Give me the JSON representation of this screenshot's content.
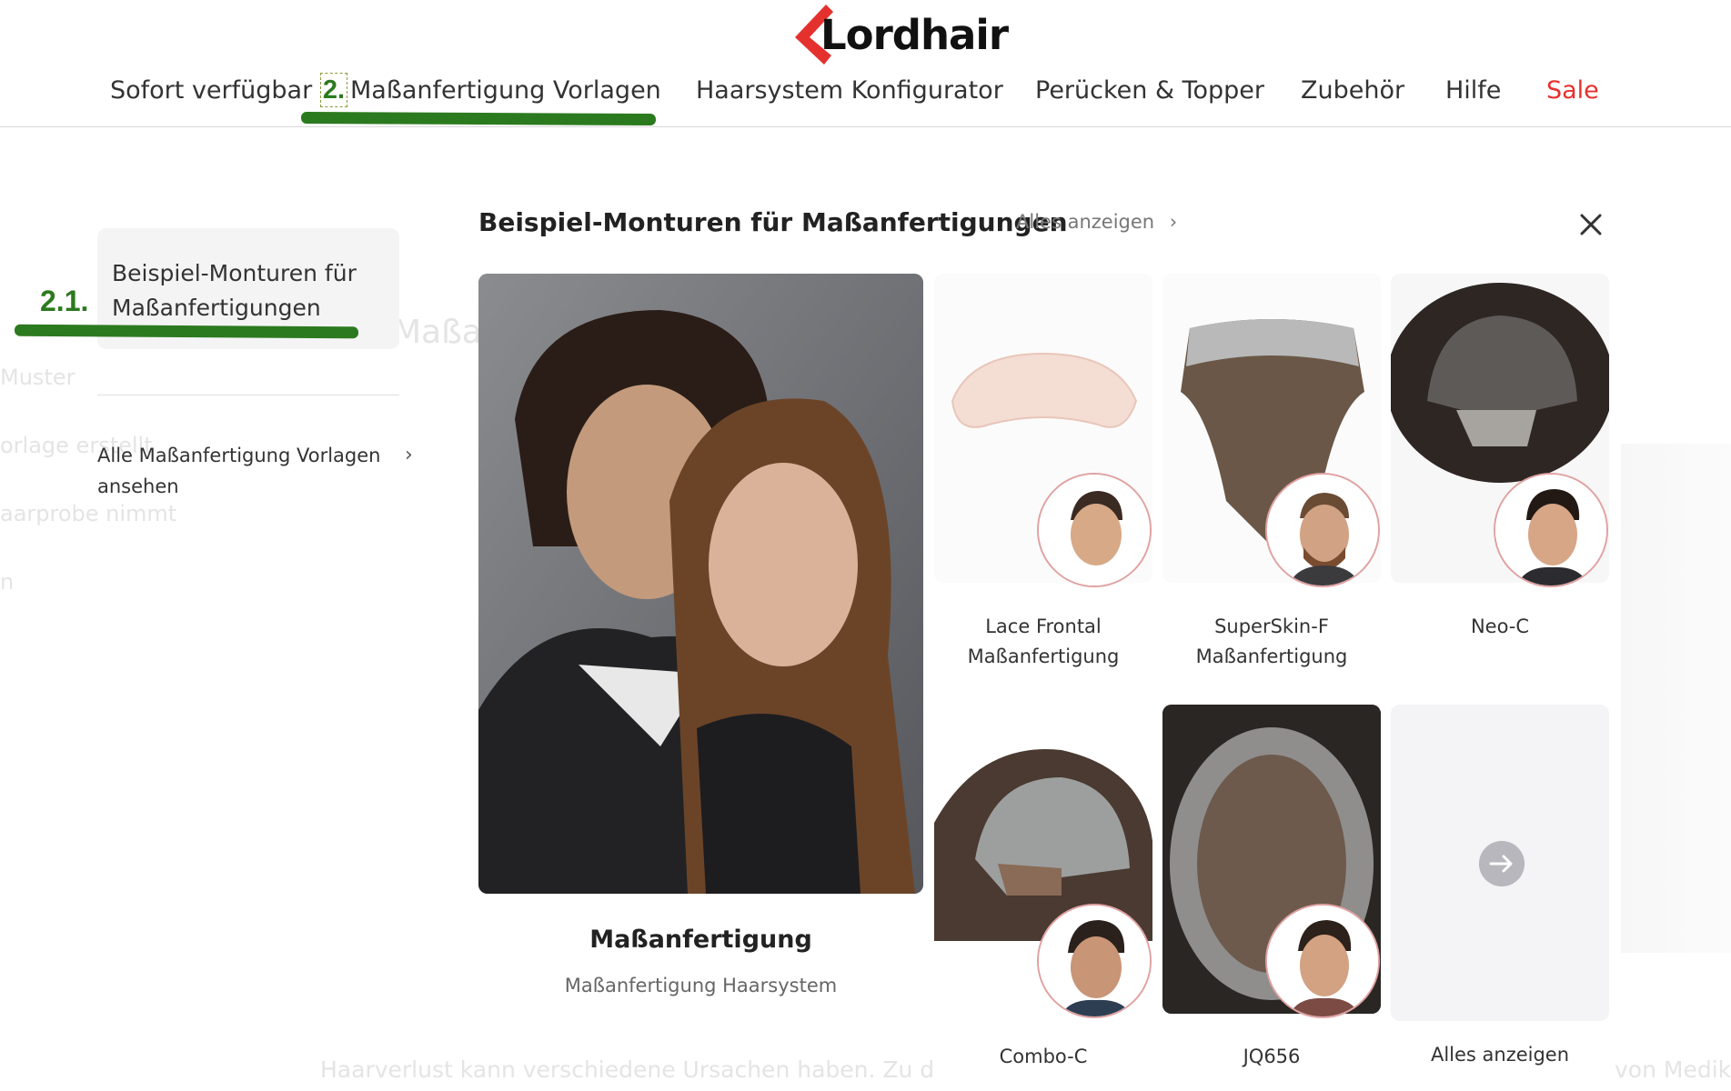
{
  "brand": {
    "name": "Lordhair",
    "accent_color": "#e5312e"
  },
  "nav": {
    "items": [
      {
        "label": "Sofort verfügbar"
      },
      {
        "label": "Maßanfertigung Vorlagen",
        "active": true
      },
      {
        "label": "Haarsystem Konfigurator"
      },
      {
        "label": "Perücken & Topper"
      },
      {
        "label": "Zubehör"
      },
      {
        "label": "Hilfe"
      },
      {
        "label": "Sale",
        "highlight": true
      }
    ]
  },
  "annotations": {
    "nav": "2.",
    "submenu": "2.1.",
    "color": "#2c7a1f"
  },
  "submenu": {
    "active_label": "Beispiel-Monturen für Maßanfertigungen",
    "all_link": "Alle Maßanfertigung Vorlagen ansehen"
  },
  "panel": {
    "title": "Beispiel-Monturen für Maßanfertigungen",
    "view_all": "Alles anzeigen",
    "hero": {
      "title": "Maßanfertigung",
      "subtitle": "Maßanfertigung Haarsystem"
    },
    "products": [
      {
        "name": "Lace Frontal Maßanfertigung"
      },
      {
        "name": "SuperSkin-F Maßanfertigung"
      },
      {
        "name": "Neo-C"
      },
      {
        "name": "Combo-C"
      },
      {
        "name": "JQ656"
      }
    ],
    "view_all_card": "Alles anzeigen"
  },
  "background_page": {
    "fragments": [
      "Maßa",
      "Muster",
      "orlage erstellt",
      "aarprobe nimmt",
      "n",
      "Haarverlust kann verschiedene Ursachen haben. Zu d",
      "von Medik"
    ]
  }
}
